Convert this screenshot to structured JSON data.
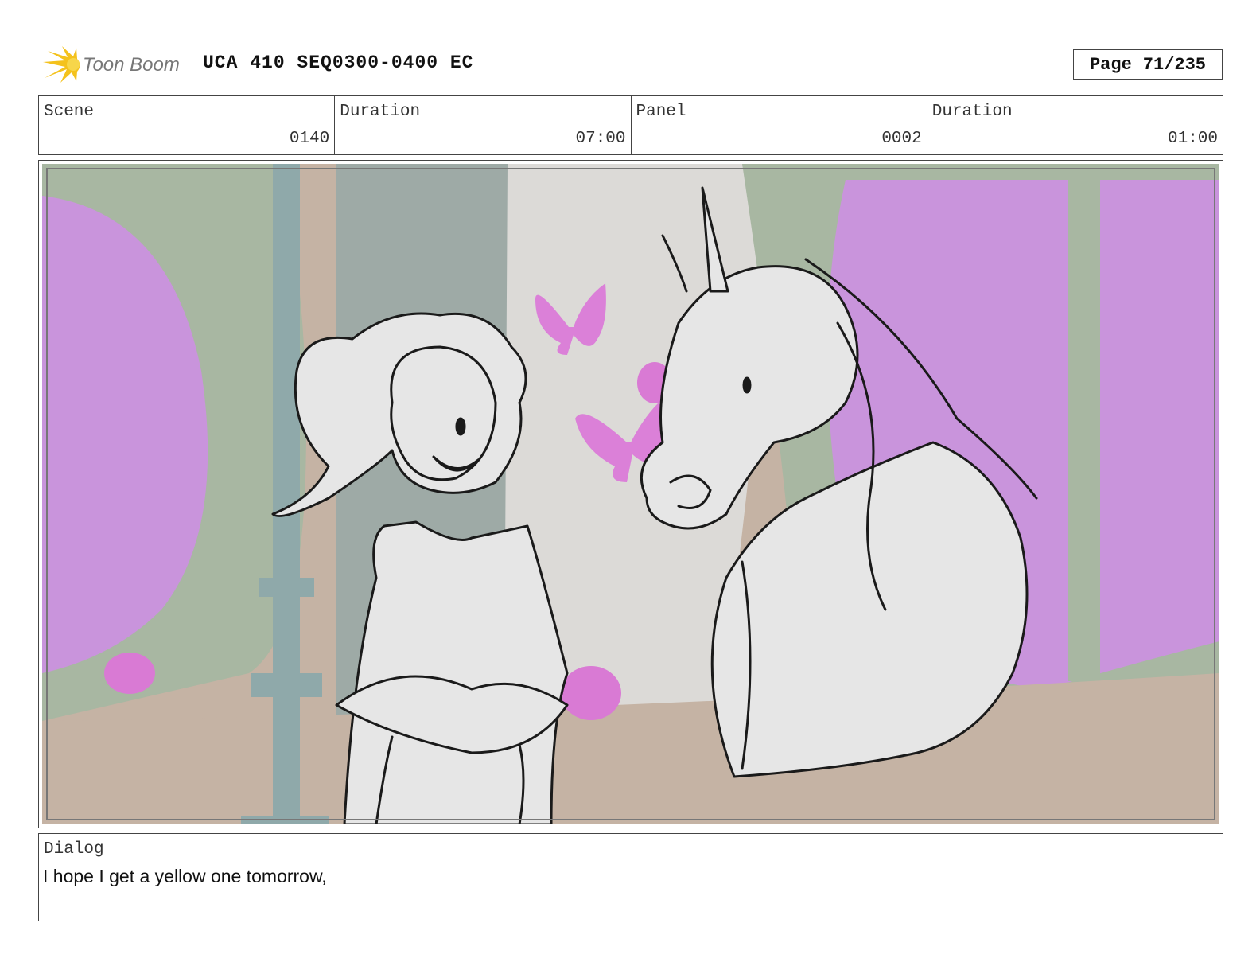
{
  "header": {
    "logo_text": "Toon Boom",
    "title": "UCA 410 SEQ0300-0400 EC",
    "page_label": "Page",
    "page_value": "71/235"
  },
  "info": {
    "scene_label": "Scene",
    "scene_value": "0140",
    "scene_duration_label": "Duration",
    "scene_duration_value": "07:00",
    "panel_label": "Panel",
    "panel_value": "0002",
    "panel_duration_label": "Duration",
    "panel_duration_value": "01:00"
  },
  "panel": {
    "colors": {
      "window_glass": "#c994dc",
      "frame_green": "#a8b7a2",
      "wall_tan": "#c5b3a4",
      "column_teal": "#8fa9aa",
      "butterfly_pink": "#db80d8",
      "sketch_fill": "#e6e6e6",
      "ink": "#1a1a1a"
    }
  },
  "dialog": {
    "label": "Dialog",
    "text": "I hope I get a yellow one tomorrow,"
  }
}
